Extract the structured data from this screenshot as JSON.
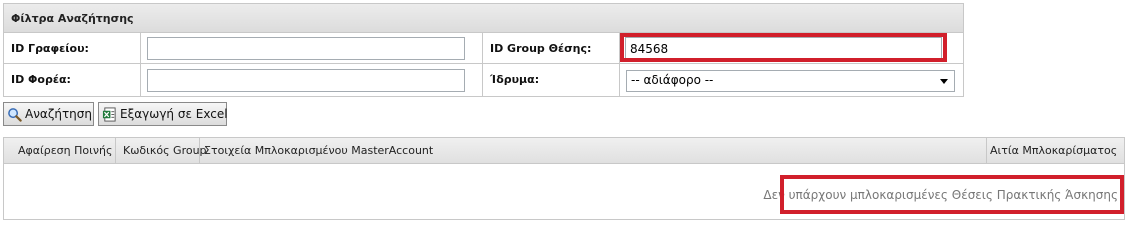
{
  "filters": {
    "title": "Φίλτρα Αναζήτησης",
    "office_id_label": "ID Γραφείου:",
    "office_id_value": "",
    "group_id_label": "ID Group Θέσης:",
    "group_id_value": "84568",
    "provider_id_label": "ID Φορέα:",
    "provider_id_value": "",
    "institution_label": "Ίδρυμα:",
    "institution_selected": "-- αδιάφορο --"
  },
  "actions": {
    "search_label": "Αναζήτηση",
    "export_label": "Εξαγωγή σε Excel"
  },
  "grid": {
    "columns": [
      "Αφαίρεση Ποινής",
      "Κωδικός Group",
      "Στοιχεία Μπλοκαρισμένου MasterAccount",
      "Αιτία Μπλοκαρίσματος"
    ],
    "empty_message": "Δεν υπάρχουν μπλοκαρισμένες Θέσεις Πρακτικής Άσκησης"
  },
  "colors": {
    "highlight": "#d11f2b"
  },
  "icons": {
    "search": "magnifier-icon",
    "export": "excel-icon"
  }
}
